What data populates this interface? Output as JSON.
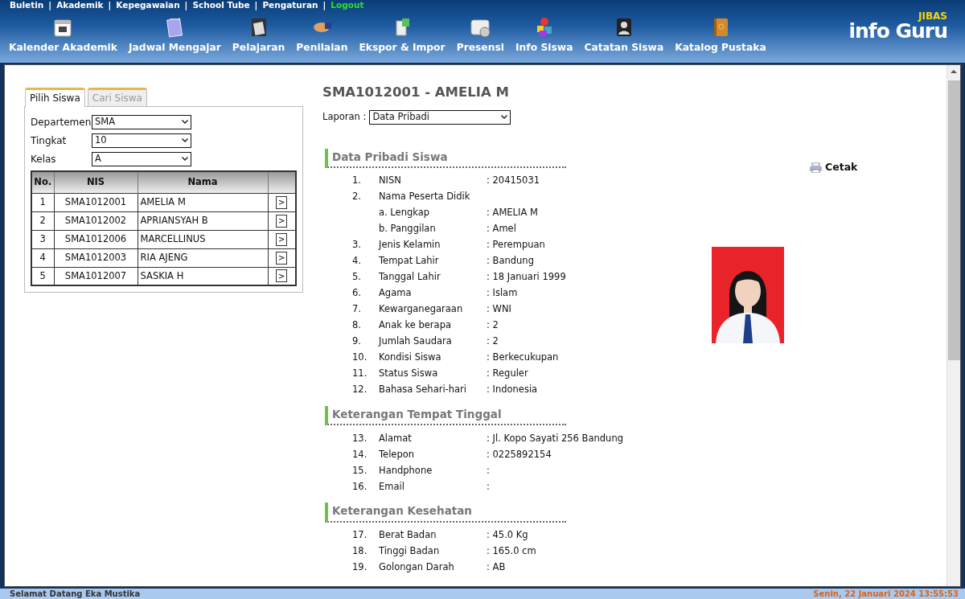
{
  "top_links": [
    {
      "label": "Buletin",
      "kind": "link"
    },
    {
      "separator": "|",
      "label": "Akademik",
      "kind": "link"
    },
    {
      "separator": "|",
      "label": "Kepegawaian",
      "kind": "link"
    },
    {
      "separator": "|",
      "label": "School Tube",
      "kind": "link"
    },
    {
      "separator": "|",
      "label": "Pengaturan",
      "kind": "link"
    },
    {
      "separator": "|",
      "label": "Logout",
      "kind": "logout"
    }
  ],
  "nav": [
    {
      "label": "Kalender Akademik"
    },
    {
      "label": "Jadwal Mengajar"
    },
    {
      "label": "Pelajaran"
    },
    {
      "label": "Penilaian"
    },
    {
      "label": "Ekspor & Impor"
    },
    {
      "label": "Presensi"
    },
    {
      "label": "Info Siswa"
    },
    {
      "label": "Catatan Siswa"
    },
    {
      "label": "Katalog Pustaka"
    }
  ],
  "logo": {
    "brand": "JIBAS",
    "title": "info Guru"
  },
  "tabs": [
    {
      "label": "Pilih Siswa",
      "selected": true
    },
    {
      "label": "Cari Siswa",
      "selected": false
    }
  ],
  "filters": [
    {
      "label": "Departemen",
      "value": "SMA"
    },
    {
      "label": "Tingkat",
      "value": "10"
    },
    {
      "label": "Kelas",
      "value": "A"
    }
  ],
  "table": {
    "columns": [
      "No.",
      "NIS",
      "Nama"
    ],
    "rows": [
      {
        "no": "1",
        "nis": "SMA1012001",
        "nama": "AMELIA M",
        "action": ">"
      },
      {
        "no": "2",
        "nis": "SMA1012002",
        "nama": "APRIANSYAH B",
        "action": ">"
      },
      {
        "no": "3",
        "nis": "SMA1012006",
        "nama": "MARCELLINUS",
        "action": ">"
      },
      {
        "no": "4",
        "nis": "SMA1012003",
        "nama": "RIA AJENG",
        "action": ">"
      },
      {
        "no": "5",
        "nis": "SMA1012007",
        "nama": "SASKIA H",
        "action": ">"
      }
    ]
  },
  "student_title": "SMA1012001 - AMELIA M",
  "report": {
    "label": "Laporan :",
    "value": "Data Pribadi"
  },
  "print_button": "Cetak",
  "sections": [
    {
      "title": "Data Pribadi Siswa",
      "fields": [
        {
          "no": "1.",
          "label": "NISN",
          "value": ": 20415031"
        },
        {
          "no": "2.",
          "label": "Nama Peserta Didik"
        },
        {
          "label": "a. Lengkap",
          "value": ": AMELIA M"
        },
        {
          "label": "b. Panggilan",
          "value": ": Amel"
        },
        {
          "no": "3.",
          "label": "Jenis Kelamin",
          "value": ": Perempuan"
        },
        {
          "no": "4.",
          "label": "Tempat Lahir",
          "value": ": Bandung"
        },
        {
          "no": "5.",
          "label": "Tanggal Lahir",
          "value": ": 18 Januari 1999"
        },
        {
          "no": "6.",
          "label": "Agama",
          "value": ": Islam"
        },
        {
          "no": "7.",
          "label": "Kewarganegaraan",
          "value": ": WNI"
        },
        {
          "no": "8.",
          "label": "Anak ke berapa",
          "value": ": 2"
        },
        {
          "no": "9.",
          "label": "Jumlah Saudara",
          "value": ": 2"
        },
        {
          "no": "10.",
          "label": "Kondisi Siswa",
          "value": ": Berkecukupan"
        },
        {
          "no": "11.",
          "label": "Status Siswa",
          "value": ": Reguler"
        },
        {
          "no": "12.",
          "label": "Bahasa Sehari-hari",
          "value": ": Indonesia"
        }
      ]
    },
    {
      "title": "Keterangan Tempat Tinggal",
      "fields": [
        {
          "no": "13.",
          "label": "Alamat",
          "value": ": Jl. Kopo Sayati 256 Bandung"
        },
        {
          "no": "14.",
          "label": "Telepon",
          "value": ": 0225892154"
        },
        {
          "no": "15.",
          "label": "Handphone",
          "value": ":"
        },
        {
          "no": "16.",
          "label": "Email",
          "value": ":"
        }
      ]
    },
    {
      "title": "Keterangan Kesehatan",
      "fields": [
        {
          "no": "17.",
          "label": "Berat Badan",
          "value": ": 45.0 Kg"
        },
        {
          "no": "18.",
          "label": "Tinggi Badan",
          "value": ": 165.0 cm"
        },
        {
          "no": "19.",
          "label": "Golongan Darah",
          "value": ": AB"
        }
      ]
    }
  ],
  "status_bar": {
    "welcome": "Selamat Datang Eka Mustika",
    "datetime": "Senin, 22 Januari 2024 13:55:53"
  }
}
